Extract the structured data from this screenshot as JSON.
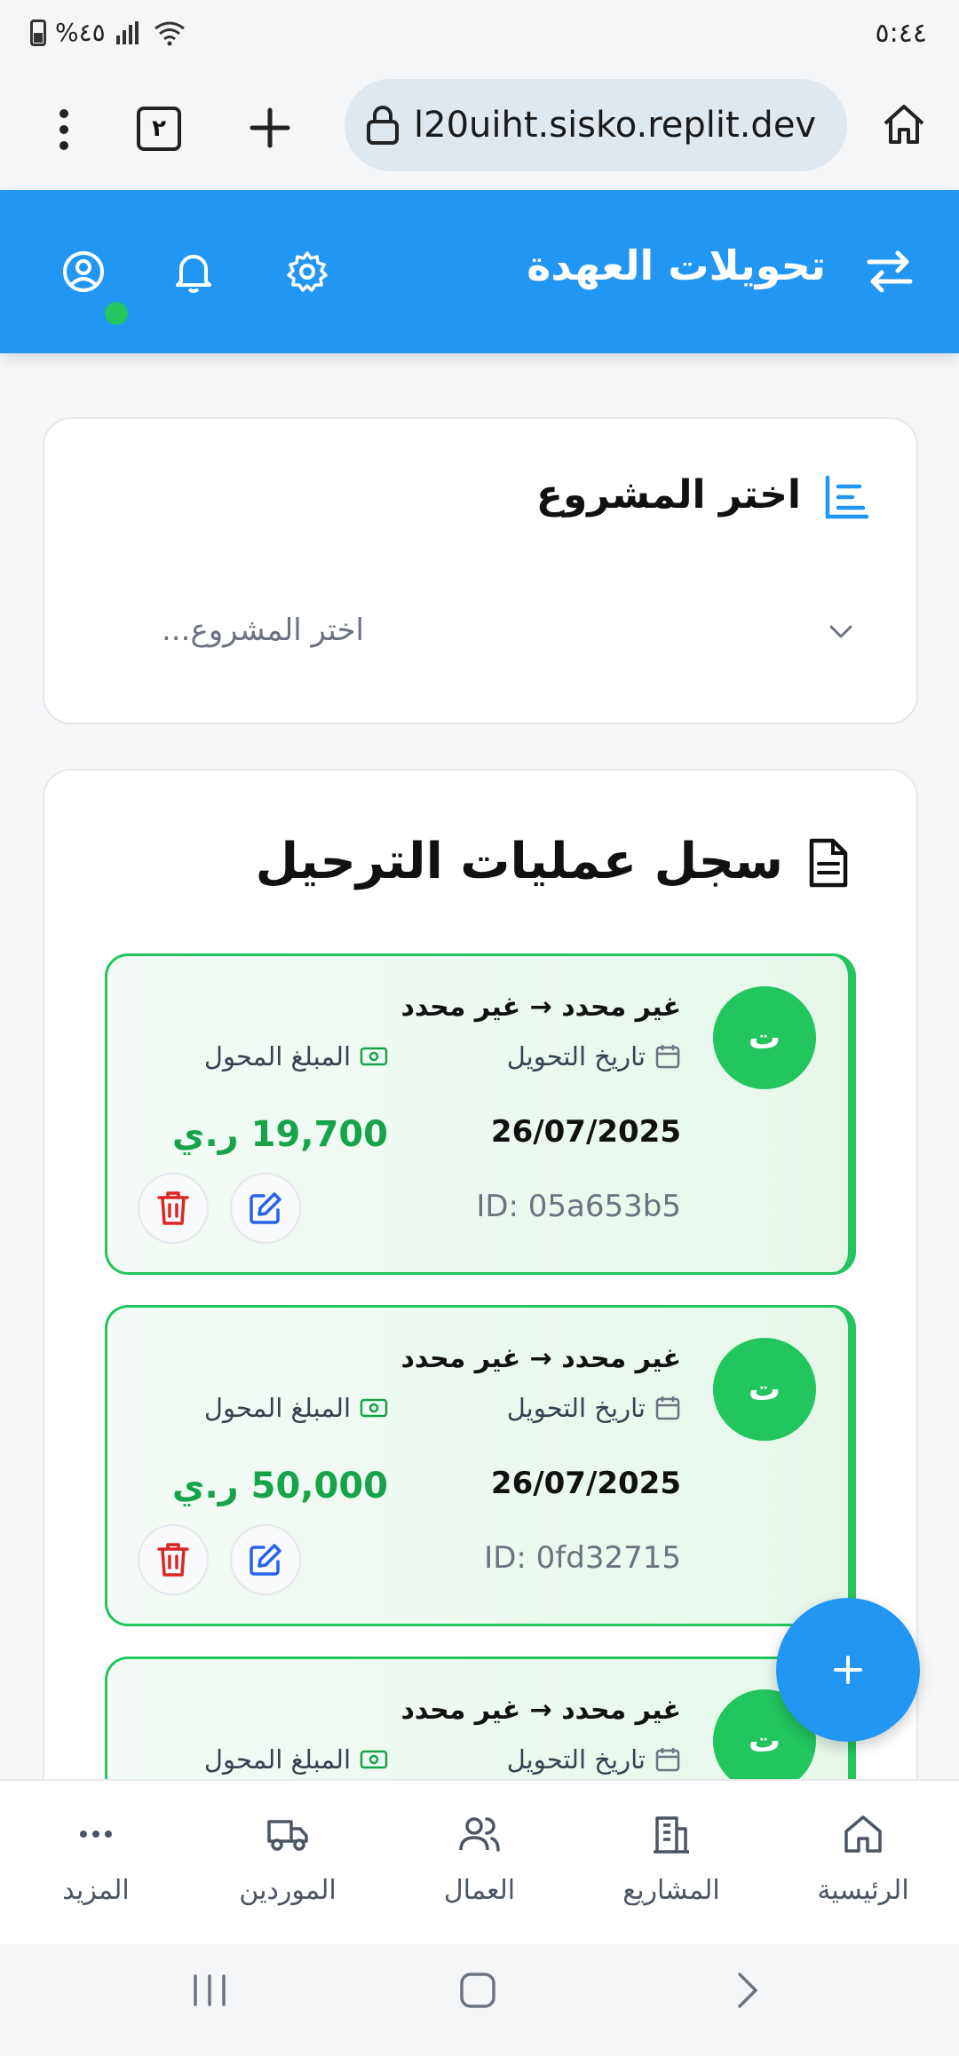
{
  "status_bar": {
    "time": "٥:٤٤",
    "battery": "%٤٥"
  },
  "browser": {
    "url": "l20uiht.sisko.replit.dev",
    "tab_count": "٢"
  },
  "header": {
    "title": "تحويلات العهدة"
  },
  "project_select": {
    "title": "اختر المشروع",
    "placeholder": "...اختر المشروع"
  },
  "history": {
    "title": "سجل عمليات الترحيل",
    "transfers": [
      {
        "avatar": "ت",
        "route": "غير محدد → غير محدد",
        "date_label": "تاريخ التحويل",
        "amount_label": "المبلغ المحول",
        "date": "26/07/2025",
        "amount": "19,700 ر.ي",
        "id": "ID: 05a653b5"
      },
      {
        "avatar": "ت",
        "route": "غير محدد → غير محدد",
        "date_label": "تاريخ التحويل",
        "amount_label": "المبلغ المحول",
        "date": "26/07/2025",
        "amount": "50,000 ر.ي",
        "id": "ID: 0fd32715"
      },
      {
        "avatar": "ت",
        "route": "غير محدد → غير محدد",
        "date_label": "تاريخ التحويل",
        "amount_label": "المبلغ المحول"
      }
    ]
  },
  "bottom_nav": {
    "home": "الرئيسية",
    "projects": "المشاريع",
    "workers": "العمال",
    "suppliers": "الموردين",
    "more": "المزيد"
  },
  "colors": {
    "primary": "#2196f3",
    "success": "#22c55e",
    "danger": "#dc2626",
    "edit": "#2563eb"
  }
}
